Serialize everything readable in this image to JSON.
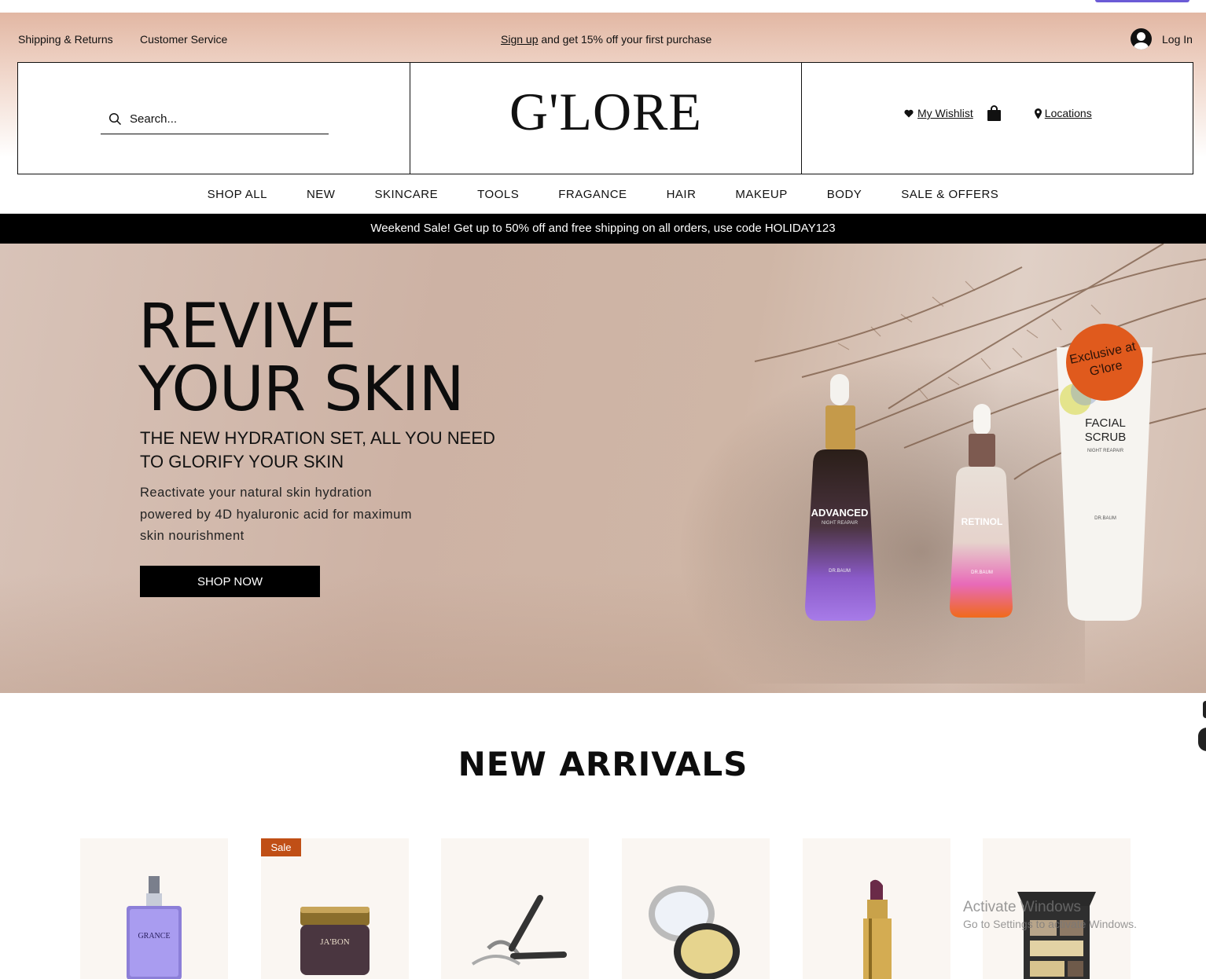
{
  "util_bar": {
    "shipping": "Shipping & Returns",
    "customer_service": "Customer Service",
    "promo_link": "Sign up",
    "promo_rest": " and get 15% off your first purchase",
    "login": "Log In"
  },
  "header": {
    "search_placeholder": "Search...",
    "logo": "G'LORE",
    "wishlist": "My Wishlist",
    "locations": "Locations"
  },
  "nav": {
    "items": [
      "SHOP ALL",
      "NEW",
      "SKINCARE",
      "TOOLS",
      "FRAGANCE",
      "HAIR",
      "MAKEUP",
      "BODY",
      "SALE & OFFERS"
    ]
  },
  "sale_bar": "Weekend Sale! Get up to 50% off and free shipping on all orders, use code HOLIDAY123",
  "hero": {
    "title_line1": "REVIVE",
    "title_line2": "YOUR SKIN",
    "subtitle": "THE NEW HYDRATION SET, ALL YOU NEED TO GLORIFY YOUR SKIN",
    "body": "Reactivate your natural skin hydration powered by 4D hyaluronic acid for maximum skin nourishment",
    "cta": "SHOP NOW",
    "badge": "Exclusive at G'lore",
    "products": {
      "bottle1_name": "ADVANCED",
      "bottle1_sub": "NIGHT REAPAIR",
      "bottle2_name": "RETINOL",
      "tube_name": "FACIAL SCRUB",
      "tube_sub": "NIGHT REAPAIR",
      "brand": "DR.BAUM"
    }
  },
  "new_arrivals": {
    "title": "NEW ARRIVALS",
    "sale_label": "Sale",
    "product_texts": [
      "GRANCE",
      "JA'BON"
    ]
  },
  "watermark": {
    "line1": "Activate Windows",
    "line2": "Go to Settings to activate Windows."
  },
  "colors": {
    "accent_orange": "#e05a1d",
    "sale_badge": "#c04f16",
    "header_gradient_top": "#e2b7a3"
  }
}
